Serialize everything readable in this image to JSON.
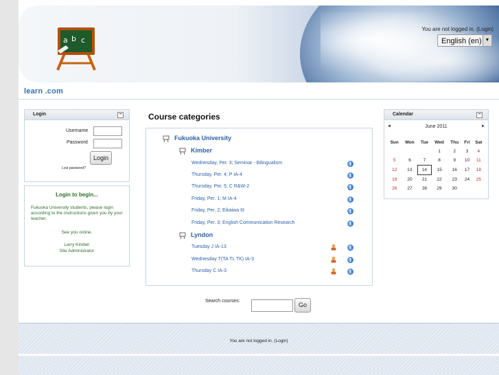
{
  "header": {
    "login_status": "You are not logged in.",
    "login_link": "(Login)",
    "language": "English (en)"
  },
  "navbar": {
    "site_name": "learn    .com"
  },
  "login_block": {
    "title": "Login",
    "username_label": "Username",
    "password_label": "Password",
    "login_button": "Login",
    "lost_password": "Lost password?"
  },
  "welcome_block": {
    "title": "Login to begin...",
    "text": "Fukuoka University students, please login according to the instructions given you by your teacher.",
    "see_you": "See you online.",
    "name": "Larry Kimber",
    "role": "Site Administrator"
  },
  "main": {
    "title": "Course categories",
    "categories": [
      {
        "name": "Fukuoka University"
      },
      {
        "name": "Kimber"
      },
      {
        "name": "Lyndon"
      }
    ],
    "kimber_courses": [
      "Wednesday, Per. 3; Seminar - Bilingualism",
      "Thursday, Per. 4; P IA-4",
      "Thursday, Per. 5; C R&W-2",
      "Friday, Per. 1; M IA-4",
      "Friday, Per. 2; Eikaiwa III",
      "Friday, Per. 3; English Communication Research"
    ],
    "lyndon_courses": [
      "Tuesday J IA-13",
      "Wednesday T(TA TL TK) IA-3",
      "Thursday C IA-3"
    ],
    "search_label": "Search courses:",
    "go_button": "Go"
  },
  "calendar": {
    "title": "Calendar",
    "month": "June 2011",
    "prev": "◄",
    "next": "►",
    "days": [
      "Sun",
      "Mon",
      "Tue",
      "Wed",
      "Thu",
      "Fri",
      "Sat"
    ],
    "weeks": [
      [
        "",
        "",
        "",
        "1",
        "2",
        "3",
        "4"
      ],
      [
        "5",
        "6",
        "7",
        "8",
        "9",
        "10",
        "11"
      ],
      [
        "12",
        "13",
        "14",
        "15",
        "16",
        "17",
        "18"
      ],
      [
        "19",
        "20",
        "21",
        "22",
        "23",
        "24",
        "25"
      ],
      [
        "26",
        "27",
        "28",
        "29",
        "30",
        "",
        ""
      ]
    ],
    "today": "14"
  },
  "footer": {
    "status": "You are not logged in.",
    "login_link": "(Login)"
  },
  "colors": {
    "link": "#2c5fa8",
    "weekend": "#c0262c",
    "welcome_text": "#2f6b2f"
  }
}
